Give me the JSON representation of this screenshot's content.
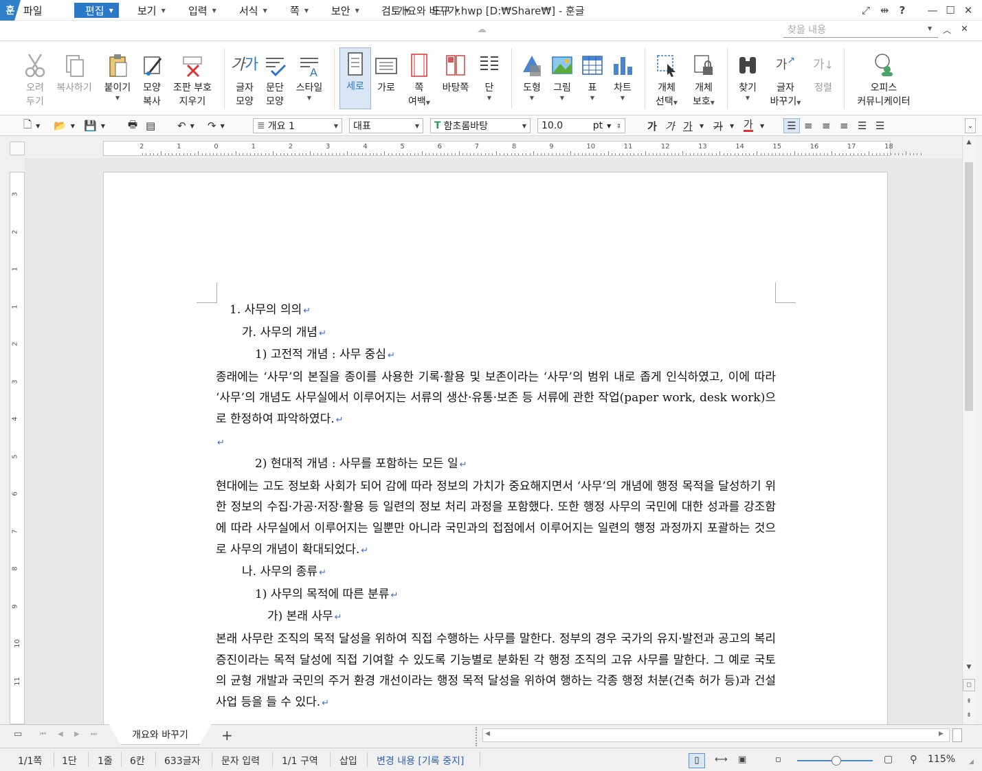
{
  "window": {
    "title": "개요와 바꾸기.hwp [D:₩Share₩] - 훈글",
    "app_logo": "훈",
    "buttons": [
      "fullscreen-icon",
      "split-icon",
      "help-icon",
      "minimize-icon",
      "maximize-icon",
      "close-icon"
    ]
  },
  "menu": {
    "items": [
      {
        "label": "파일"
      },
      {
        "label": "편집",
        "active": true
      },
      {
        "label": "보기"
      },
      {
        "label": "입력"
      },
      {
        "label": "서식"
      },
      {
        "label": "쪽"
      },
      {
        "label": "보안"
      },
      {
        "label": "검토"
      },
      {
        "label": "도구"
      }
    ],
    "search_placeholder": "찾을 내용"
  },
  "ribbon": {
    "cut": {
      "line1": "오려",
      "line2": "두기"
    },
    "copy": {
      "line1": "복사하기"
    },
    "paste": {
      "line1": "붙이기"
    },
    "format_copy": {
      "line1": "모양",
      "line2": "복사"
    },
    "clear_marks": {
      "line1": "조판 부호",
      "line2": "지우기"
    },
    "char_shape": {
      "line1": "글자",
      "line2": "모양"
    },
    "para_shape": {
      "line1": "문단",
      "line2": "모양"
    },
    "style": {
      "line1": "스타일"
    },
    "vertical": {
      "line1": "세로"
    },
    "horizontal": {
      "line1": "가로"
    },
    "page_margin": {
      "line1": "쪽",
      "line2": "여백"
    },
    "background": {
      "line1": "바탕쪽"
    },
    "columns": {
      "line1": "단"
    },
    "shape": {
      "line1": "도형"
    },
    "picture": {
      "line1": "그림"
    },
    "table": {
      "line1": "표"
    },
    "chart": {
      "line1": "차트"
    },
    "obj_select": {
      "line1": "개체",
      "line2": "선택"
    },
    "obj_protect": {
      "line1": "개체",
      "line2": "보호"
    },
    "find": {
      "line1": "찾기"
    },
    "replace": {
      "line1": "글자",
      "line2": "바꾸기"
    },
    "sort": {
      "line1": "정렬"
    },
    "office": {
      "line1": "오피스",
      "line2": "커뮤니케이터"
    }
  },
  "format_bar": {
    "style_value": "개요 1",
    "lang_value": "대표",
    "font_value": "함초롬바탕",
    "size_value": "10.0",
    "size_unit": "pt",
    "bold": "가",
    "italic": "가",
    "underline": "가",
    "strike": "가",
    "color": "가"
  },
  "ruler": {
    "h_ticks": [
      "2",
      "1",
      "0",
      "1",
      "2",
      "3",
      "4",
      "5",
      "6",
      "7",
      "8",
      "9",
      "10",
      "11",
      "12",
      "13",
      "14",
      "15",
      "16",
      "17",
      "18"
    ],
    "v_ticks": [
      "3",
      "2",
      "1",
      "1",
      "2",
      "3",
      "4",
      "5",
      "6",
      "7",
      "8",
      "9",
      "10",
      "11"
    ]
  },
  "document": {
    "lines": [
      {
        "text": "1. 사무의 의의",
        "level": "h1"
      },
      {
        "text": "가. 사무의 개념",
        "level": "h2"
      },
      {
        "text": "1) 고전적 개념 : 사무 중심",
        "level": "h3"
      },
      {
        "text": "종래에는 ‘사무’의 본질을 종이를 사용한 기록·활용 및 보존이라는 ‘사무’의 범위 내로 좁게 인식하였고, 이에 따라 ‘사무’의 개념도 사무실에서 이루어지는 서류의 생산·유통·보존 등 서류에 관한 작업(paper work, desk work)으로 한정하여 파악하였다.",
        "level": "p"
      },
      {
        "text": "",
        "level": "p"
      },
      {
        "text": "2) 현대적 개념 : 사무를 포함하는 모든 일",
        "level": "h3"
      },
      {
        "text": "현대에는 고도 정보화 사회가 되어 감에 따라 정보의 가치가 중요해지면서 ‘사무’의 개념에 행정 목적을 달성하기 위한 정보의 수집·가공·저장·활용 등 일련의 정보 처리 과정을 포함했다. 또한 행정 사무의 국민에 대한 성과를 강조함에 따라 사무실에서 이루어지는 일뿐만 아니라 국민과의 접점에서 이루어지는 일련의 행정 과정까지 포괄하는 것으로 사무의 개념이 확대되었다.",
        "level": "p"
      },
      {
        "text": "나. 사무의 종류",
        "level": "h2"
      },
      {
        "text": "1) 사무의 목적에 따른 분류",
        "level": "h3"
      },
      {
        "text": "가) 본래 사무",
        "level": "h4"
      },
      {
        "text": "본래 사무란 조직의 목적 달성을 위하여 직접 수행하는 사무를 말한다. 정부의 경우 국가의 유지·발전과 공고의 복리 증진이라는 목적 달성에 직접 기여할 수 있도록 기능별로 분화된 각 행정 조직의 고유 사무를 말한다. 그 예로 국토의 균형 개발과 국민의 주거 환경 개선이라는 행정 목적 달성을 위하여 행하는 각종 행정 처분(건축 허가 등)과 건설 사업 등을 들 수 있다.",
        "level": "p"
      }
    ]
  },
  "tabs": {
    "doc_tab": "개요와 바꾸기",
    "add": "+"
  },
  "status": {
    "page": "1/1쪽",
    "column": "1단",
    "line": "1줄",
    "col": "6칸",
    "chars": "633글자",
    "input_mode": "문자 입력",
    "section": "1/1 구역",
    "insert": "삽입",
    "track": "변경 내용 [기록 중지]",
    "zoom": "115%"
  },
  "colors": {
    "accent": "#2b78c6",
    "paragraph_mark": "#3a6fd8",
    "track_text": "#2b5fb4"
  }
}
